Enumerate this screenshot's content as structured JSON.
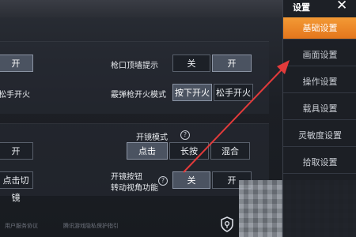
{
  "sidebar": {
    "title": "设置",
    "close_glyph": "✕",
    "items": [
      {
        "label": "基础设置",
        "active": true
      },
      {
        "label": "画面设置",
        "active": false
      },
      {
        "label": "操作设置",
        "active": false
      },
      {
        "label": "载具设置",
        "active": false
      },
      {
        "label": "灵敏度设置",
        "active": false
      },
      {
        "label": "拾取设置",
        "active": false
      }
    ]
  },
  "section1": {
    "left_on": "开",
    "left_release_fire": "松手开火",
    "wall_hint": {
      "label": "枪口顶墙提示",
      "off": "关",
      "on": "开",
      "selected": "on"
    },
    "shotgun_fire": {
      "label": "霰弹枪开火模式",
      "press": "按下开火",
      "release": "松手开火",
      "selected": "press"
    }
  },
  "section2": {
    "left_on": "开",
    "left_tap_switch": "点击切镜",
    "scope_mode": {
      "label": "开镜模式",
      "help": "?",
      "tap": "点击",
      "hold": "长按",
      "mixed": "混合",
      "selected": "tap"
    },
    "scope_rotate": {
      "label_line1": "开镜按钮",
      "label_line2": "转动视角功能",
      "help": "?",
      "off": "关",
      "on": "开",
      "selected": "off"
    }
  },
  "footer": {
    "left_text": "用户服务协议",
    "center_text": "腾讯游戏隐私保护指引"
  },
  "colors": {
    "accent": "#e8821f",
    "arrow": "#e23b3b"
  }
}
